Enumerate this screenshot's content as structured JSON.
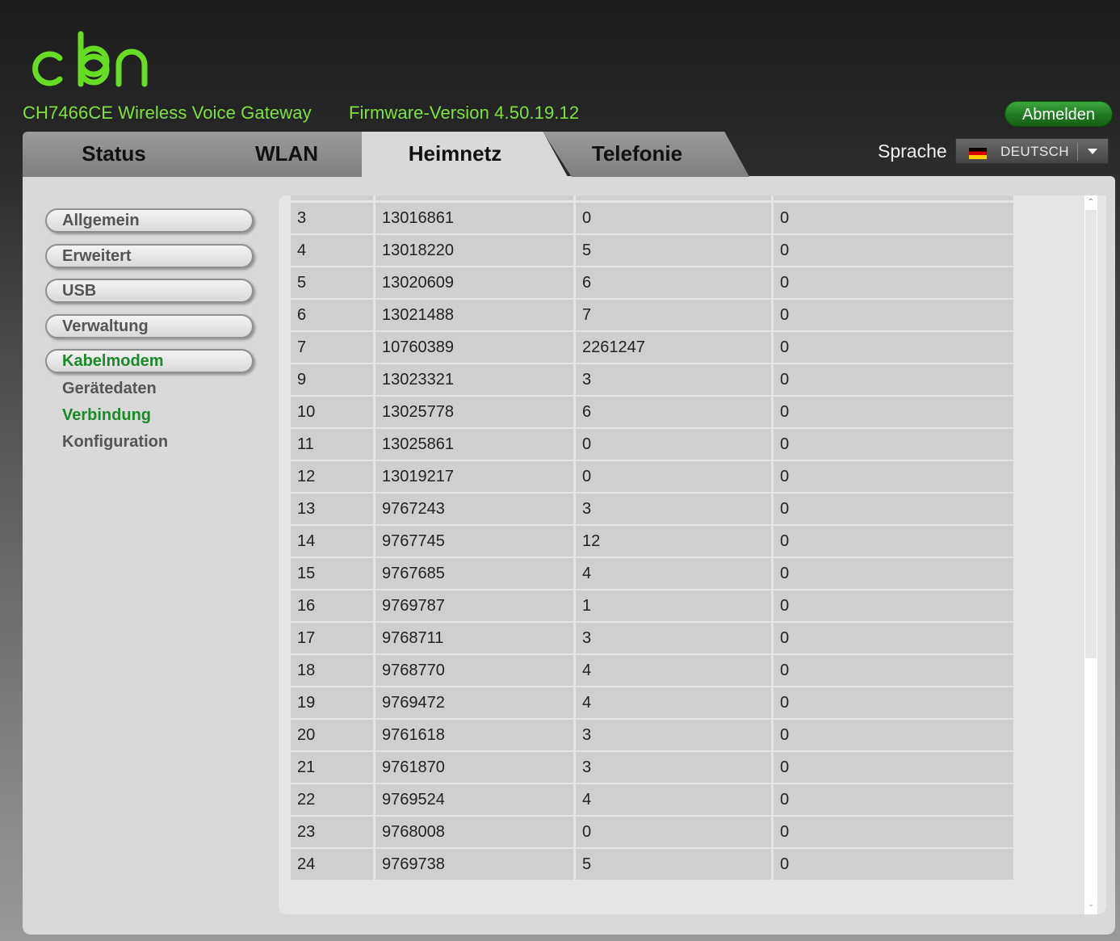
{
  "header": {
    "product_name": "CH7466CE  Wireless Voice Gateway",
    "firmware_text": "Firmware-Version  4.50.19.12",
    "logout_label": "Abmelden",
    "logo_color": "#66dd22",
    "logo_icon": "cbn-logo"
  },
  "tabs": [
    {
      "label": "Status",
      "active": false
    },
    {
      "label": "WLAN",
      "active": false
    },
    {
      "label": "Heimnetz",
      "active": true
    },
    {
      "label": "Telefonie",
      "active": false
    }
  ],
  "language": {
    "label": "Sprache",
    "value": "DEUTSCH",
    "flag_icon": "germany-flag-icon"
  },
  "sidebar": {
    "menu": [
      {
        "label": "Allgemein",
        "active": false
      },
      {
        "label": "Erweitert",
        "active": false
      },
      {
        "label": "USB",
        "active": false
      },
      {
        "label": "Verwaltung",
        "active": false
      },
      {
        "label": "Kabelmodem",
        "active": true
      }
    ],
    "submenu": [
      {
        "label": "Gerätedaten",
        "active": false
      },
      {
        "label": "Verbindung",
        "active": true
      },
      {
        "label": "Konfiguration",
        "active": false
      }
    ]
  },
  "table": {
    "rows": [
      [
        "3",
        "13016861",
        "0",
        "0"
      ],
      [
        "4",
        "13018220",
        "5",
        "0"
      ],
      [
        "5",
        "13020609",
        "6",
        "0"
      ],
      [
        "6",
        "13021488",
        "7",
        "0"
      ],
      [
        "7",
        "10760389",
        "2261247",
        "0"
      ],
      [
        "9",
        "13023321",
        "3",
        "0"
      ],
      [
        "10",
        "13025778",
        "6",
        "0"
      ],
      [
        "11",
        "13025861",
        "0",
        "0"
      ],
      [
        "12",
        "13019217",
        "0",
        "0"
      ],
      [
        "13",
        "9767243",
        "3",
        "0"
      ],
      [
        "14",
        "9767745",
        "12",
        "0"
      ],
      [
        "15",
        "9767685",
        "4",
        "0"
      ],
      [
        "16",
        "9769787",
        "1",
        "0"
      ],
      [
        "17",
        "9768711",
        "3",
        "0"
      ],
      [
        "18",
        "9768770",
        "4",
        "0"
      ],
      [
        "19",
        "9769472",
        "4",
        "0"
      ],
      [
        "20",
        "9761618",
        "3",
        "0"
      ],
      [
        "21",
        "9761870",
        "3",
        "0"
      ],
      [
        "22",
        "9769524",
        "4",
        "0"
      ],
      [
        "23",
        "9768008",
        "0",
        "0"
      ],
      [
        "24",
        "9769738",
        "5",
        "0"
      ]
    ]
  },
  "colors": {
    "accent_green": "#7ee13c",
    "active_menu_green": "#1b8a2a",
    "logout_button_green": "#2a8f2a"
  }
}
